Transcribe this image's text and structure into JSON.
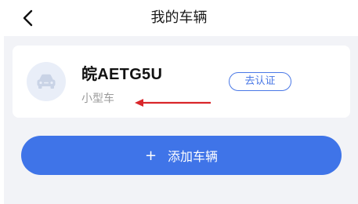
{
  "header": {
    "title": "我的车辆"
  },
  "vehicle": {
    "plate": "皖AETG5U",
    "type": "小型车",
    "verify_label": "去认证"
  },
  "actions": {
    "add_plus": "+",
    "add_label": "添加车辆"
  },
  "icons": {
    "back": "chevron-left-icon",
    "car": "car-icon",
    "annotation": "arrow-left-icon"
  },
  "colors": {
    "accent": "#3f74e8",
    "background": "#f2f3f7",
    "annotation": "#d9262a"
  }
}
